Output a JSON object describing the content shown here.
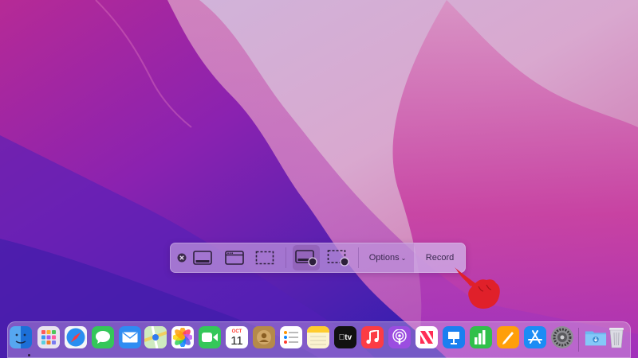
{
  "toolbar": {
    "buttons": [
      {
        "name": "close",
        "icon": "close-icon"
      },
      {
        "name": "capture-entire-screen",
        "icon": "screen-icon"
      },
      {
        "name": "capture-window",
        "icon": "window-icon"
      },
      {
        "name": "capture-selection",
        "icon": "dashed-selection-icon"
      },
      {
        "name": "record-entire-screen",
        "icon": "screen-record-icon",
        "selected": true
      },
      {
        "name": "record-selection",
        "icon": "selection-record-icon"
      }
    ],
    "options_label": "Options",
    "options_chevron": "⌄",
    "record_label": "Record"
  },
  "calendar": {
    "month": "OCT",
    "day": "11"
  },
  "tv_label": "tv",
  "dock": {
    "apps": [
      {
        "name": "Finder",
        "icon": "finder-icon",
        "running": true
      },
      {
        "name": "Launchpad",
        "icon": "launchpad-icon"
      },
      {
        "name": "Safari",
        "icon": "safari-icon"
      },
      {
        "name": "Messages",
        "icon": "messages-icon"
      },
      {
        "name": "Mail",
        "icon": "mail-icon"
      },
      {
        "name": "Maps",
        "icon": "maps-icon"
      },
      {
        "name": "Photos",
        "icon": "photos-icon"
      },
      {
        "name": "FaceTime",
        "icon": "facetime-icon"
      },
      {
        "name": "Calendar",
        "icon": "calendar-icon"
      },
      {
        "name": "Contacts",
        "icon": "contacts-icon"
      },
      {
        "name": "Reminders",
        "icon": "reminders-icon"
      },
      {
        "name": "Notes",
        "icon": "notes-icon"
      },
      {
        "name": "TV",
        "icon": "tv-icon"
      },
      {
        "name": "Music",
        "icon": "music-icon"
      },
      {
        "name": "Podcasts",
        "icon": "podcasts-icon"
      },
      {
        "name": "News",
        "icon": "news-icon"
      },
      {
        "name": "Keynote",
        "icon": "keynote-icon"
      },
      {
        "name": "Numbers",
        "icon": "numbers-icon"
      },
      {
        "name": "Pages",
        "icon": "pages-icon"
      },
      {
        "name": "App Store",
        "icon": "app-store-icon"
      },
      {
        "name": "System Preferences",
        "icon": "system-preferences-icon"
      },
      {
        "name": "Downloads",
        "icon": "downloads-folder-icon"
      },
      {
        "name": "Trash",
        "icon": "trash-icon"
      }
    ]
  },
  "colors": {
    "wallpaper_top": "#c9b7e0",
    "wallpaper_magenta": "#c02a9e",
    "wallpaper_violet": "#5a1fb0",
    "cursor_red": "#e0202a"
  }
}
